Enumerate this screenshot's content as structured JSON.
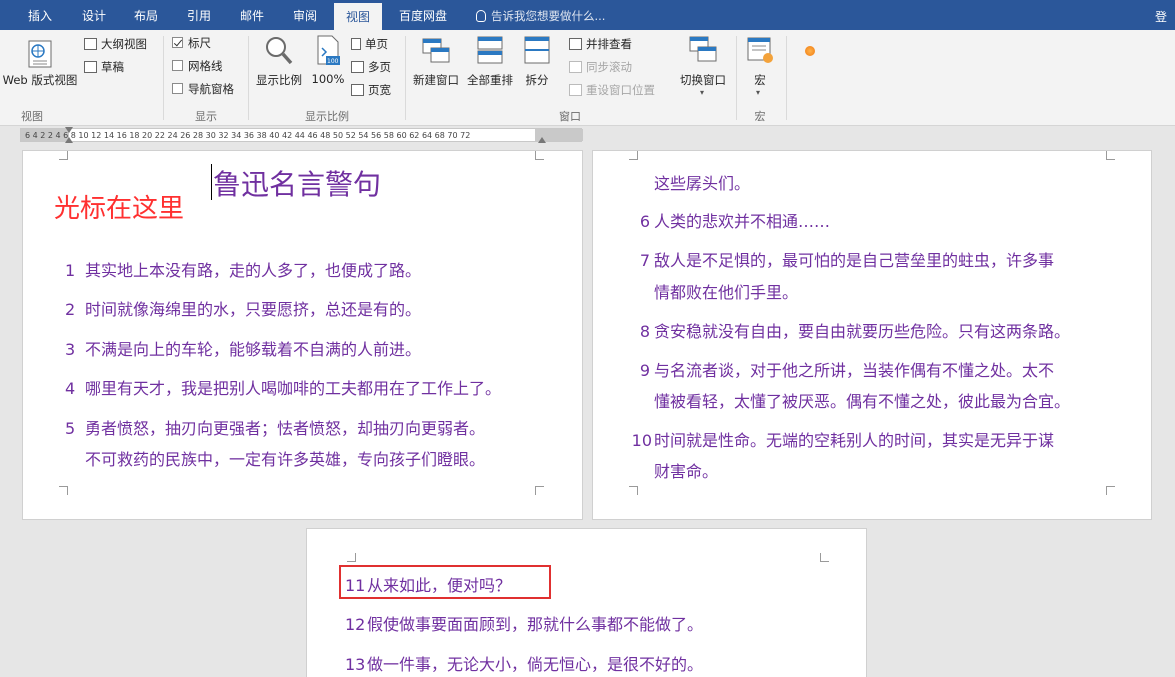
{
  "tabs": [
    "插入",
    "设计",
    "布局",
    "引用",
    "邮件",
    "审阅",
    "视图",
    "百度网盘"
  ],
  "active_tab": "视图",
  "tell_me": "告诉我您想要做什么...",
  "login": "登录",
  "ribbon": {
    "groups": {
      "views": "视图",
      "show": "显示",
      "zoom": "显示比例",
      "window": "窗口",
      "macros": "宏"
    },
    "web_layout": "Web 版式视图",
    "outline": "大纲视图",
    "draft": "草稿",
    "ruler": "标尺",
    "gridlines": "网格线",
    "nav_pane": "导航窗格",
    "zoom": "显示比例",
    "zoom_100": "100%",
    "one_page": "单页",
    "multi_page": "多页",
    "page_width": "页宽",
    "new_window": "新建窗口",
    "arrange_all": "全部重排",
    "split": "拆分",
    "side_by_side": "并排查看",
    "sync_scroll": "同步滚动",
    "reset_pos": "重设窗口位置",
    "switch_windows": "切换窗口",
    "macros": "宏"
  },
  "ruler_numbers": "6  4  2     2   4   6   8  10 12 14 16 18 20 22 24 26 28 30 32 34 36 38 40 42 44 46 48 50 52 54 56 58 60 62 64      68 70 72",
  "doc": {
    "cursor_note": "光标在这里",
    "title": "鲁迅名言警句",
    "page1": [
      {
        "num": "1",
        "text": "其实地上本没有路，走的人多了，也便成了路。"
      },
      {
        "num": "2",
        "text": "时间就像海绵里的水，只要愿挤，总还是有的。"
      },
      {
        "num": "3",
        "text": "不满是向上的车轮，能够载着不自满的人前进。"
      },
      {
        "num": "4",
        "text": "哪里有天才，我是把别人喝咖啡的工夫都用在了工作上了。"
      },
      {
        "num": "5",
        "text": "勇者愤怒，抽刃向更强者；怯者愤怒，却抽刃向更弱者。"
      },
      {
        "num": "",
        "text": "不可救药的民族中，一定有许多英雄，专向孩子们瞪眼。"
      }
    ],
    "page2": [
      {
        "num": "",
        "text": "这些孱头们。"
      },
      {
        "num": "6",
        "text": "人类的悲欢并不相通……"
      },
      {
        "num": "7",
        "text": "敌人是不足惧的，最可怕的是自己营垒里的蛀虫，许多事"
      },
      {
        "num": "",
        "text": "情都败在他们手里。"
      },
      {
        "num": "8",
        "text": "贪安稳就没有自由，要自由就要历些危险。只有这两条路。"
      },
      {
        "num": "9",
        "text": "与名流者谈，对于他之所讲，当装作偶有不懂之处。太不"
      },
      {
        "num": "",
        "text": "懂被看轻，太懂了被厌恶。偶有不懂之处，彼此最为合宜。"
      },
      {
        "num": "10",
        "text": "时间就是性命。无端的空耗别人的时间，其实是无异于谋"
      },
      {
        "num": "",
        "text": "财害命。"
      }
    ],
    "page3": [
      {
        "num": "11",
        "text": "从来如此，便对吗？"
      },
      {
        "num": "12",
        "text": "假使做事要面面顾到，那就什么事都不能做了。"
      },
      {
        "num": "13",
        "text": "做一件事，无论大小，倘无恒心，是很不好的。"
      }
    ]
  }
}
